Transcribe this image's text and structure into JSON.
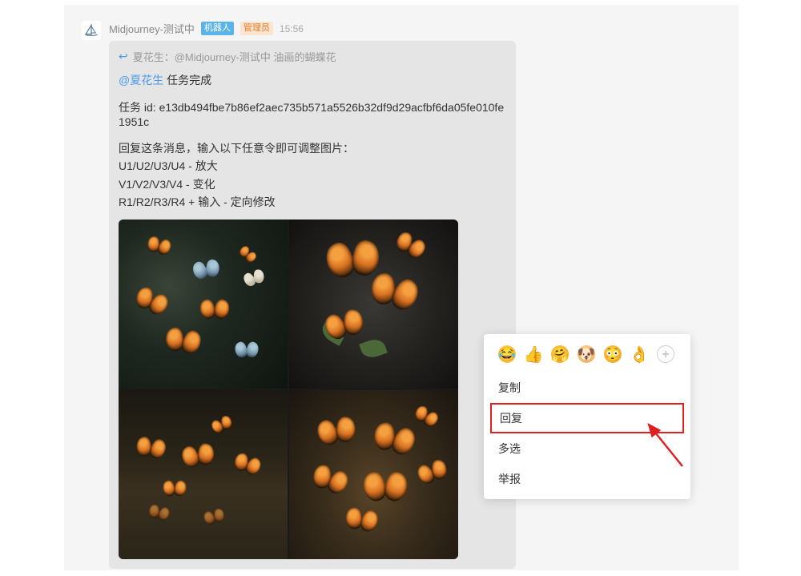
{
  "message": {
    "bot_name": "Midjourney-测试中",
    "tag_bot": "机器人",
    "tag_admin": "管理员",
    "timestamp": "15:56",
    "reply_to": "夏花生：@Midjourney-测试中 油画的蝴蝶花",
    "mention": "@夏花生",
    "completion": "任务完成",
    "task_id_label": "任务 id: e13db494fbe7b86ef2aec735b571a5526b32df9d29acfbf6da05fe010fe1951c",
    "instructions_intro": "回复这条消息，输入以下任意令即可调整图片：",
    "instructions_u": "U1/U2/U3/U4 - 放大",
    "instructions_v": "V1/V2/V3/V4 - 变化",
    "instructions_r": "R1/R2/R3/R4 + 输入 - 定向修改"
  },
  "context_menu": {
    "items": [
      "复制",
      "回复",
      "多选",
      "举报"
    ],
    "highlighted_index": 1
  },
  "emoji_icons": [
    "laugh-cry",
    "thumbs-up",
    "hug",
    "dog",
    "shy",
    "ok-hand",
    "add-reaction"
  ]
}
